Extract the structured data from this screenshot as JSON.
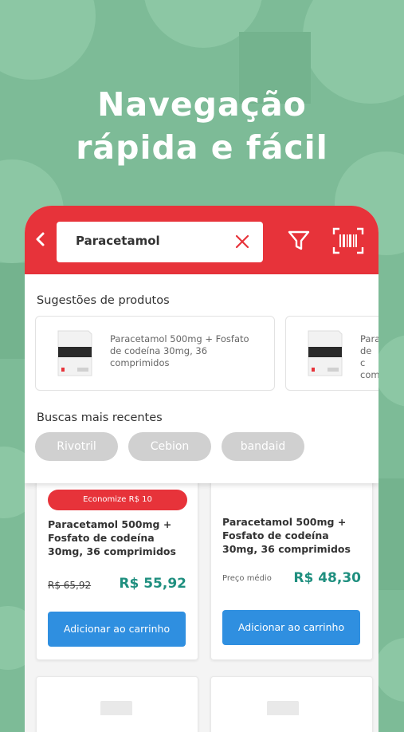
{
  "headline": {
    "line1": "Navegação",
    "line2": "rápida e fácil"
  },
  "colors": {
    "brand_red": "#e7333a",
    "accent_green": "#1f8f7f",
    "button_blue": "#2f8fe0",
    "background_green": "#7dbb97"
  },
  "search": {
    "value": "Paracetamol"
  },
  "icons": {
    "back": "chevron-left-icon",
    "clear": "close-icon",
    "filter": "filter-icon",
    "barcode": "barcode-scan-icon"
  },
  "suggestions": {
    "title": "Sugestões de produtos",
    "items": [
      {
        "text": "Paracetamol 500mg + Fosfato de codeína 30mg, 36 comprimidos"
      },
      {
        "text": "Para de c com"
      }
    ]
  },
  "recent": {
    "title": "Buscas mais recentes",
    "chips": [
      "Rivotril",
      "Cebion",
      "bandaid"
    ]
  },
  "products": [
    {
      "badge": "Economize R$ 10",
      "name": "Paracetamol 500mg + Fosfato de codeína 30mg, 36 comprimidos",
      "old_price": "R$ 65,92",
      "price": "R$ 55,92",
      "cta": "Adicionar ao carrinho"
    },
    {
      "name": "Paracetamol 500mg + Fosfato de codeína 30mg, 36 comprimidos",
      "price_note": "Preço médio",
      "price": "R$ 48,30",
      "cta": "Adicionar ao carrinho"
    }
  ]
}
